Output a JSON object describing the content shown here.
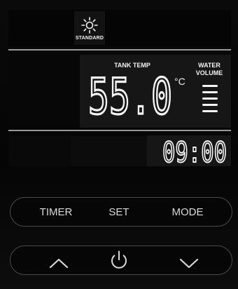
{
  "mode": {
    "label": "STANDARD",
    "icon": "sun-icon"
  },
  "display": {
    "tank_label": "TANK TEMP",
    "temperature": "55.0",
    "unit": "°C",
    "water_label_line1": "WATER",
    "water_label_line2": "VOLUME",
    "water_volume_bars": 5,
    "clock": "09:00"
  },
  "buttons": {
    "timer": "TIMER",
    "set": "SET",
    "mode": "MODE",
    "up_icon": "chevron-up-icon",
    "power_icon": "power-icon",
    "down_icon": "chevron-down-icon"
  },
  "colors": {
    "display_text": "#f5f5f5",
    "button_text": "#d9d9d9",
    "pill_border": "#4a4a4a",
    "divider": "#9a9a9a"
  }
}
